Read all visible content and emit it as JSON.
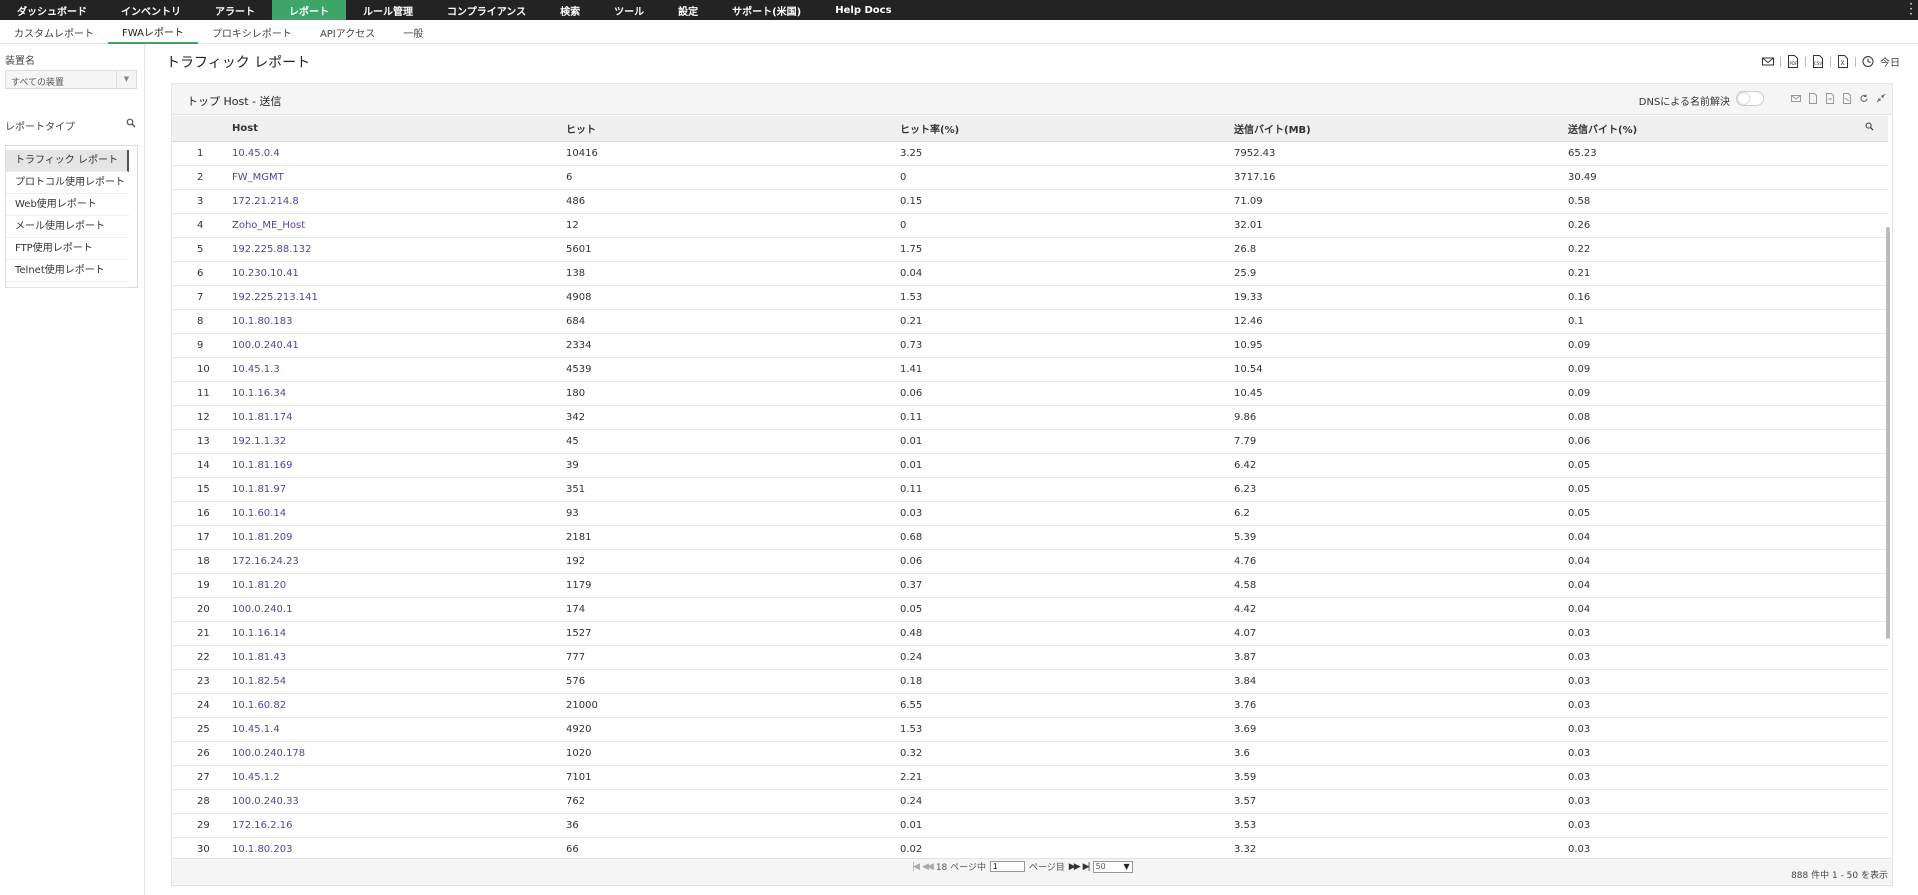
{
  "topnav": {
    "items": [
      "ダッシュボード",
      "インベントリ",
      "アラート",
      "レポート",
      "ルール管理",
      "コンプライアンス",
      "検索",
      "ツール",
      "設定",
      "サポート(米国)",
      "Help Docs"
    ]
  },
  "subnav": {
    "items": [
      "カスタムレポート",
      "FWAレポート",
      "プロキシレポート",
      "APIアクセス",
      "一般"
    ]
  },
  "sidebar": {
    "device_label": "装置名",
    "device_value": "すべての装置",
    "report_type_label": "レポートタイプ",
    "reports": [
      "トラフィック レポート",
      "プロトコル使用レポート",
      "Web使用レポート",
      "メール使用レポート",
      "FTP使用レポート",
      "Telnet使用レポート"
    ]
  },
  "header": {
    "title": "トラフィック レポート",
    "today": "今日"
  },
  "panel": {
    "title": "トップ Host - 送信",
    "dns_label": "DNSによる名前解決"
  },
  "table": {
    "columns": [
      "",
      "Host",
      "ヒット",
      "ヒット率(%)",
      "送信バイト(MB)",
      "送信バイト(%)"
    ],
    "rows": [
      [
        "1",
        "10.45.0.4",
        "10416",
        "3.25",
        "7952.43",
        "65.23"
      ],
      [
        "2",
        "FW_MGMT",
        "6",
        "0",
        "3717.16",
        "30.49"
      ],
      [
        "3",
        "172.21.214.8",
        "486",
        "0.15",
        "71.09",
        "0.58"
      ],
      [
        "4",
        "Zoho_ME_Host",
        "12",
        "0",
        "32.01",
        "0.26"
      ],
      [
        "5",
        "192.225.88.132",
        "5601",
        "1.75",
        "26.8",
        "0.22"
      ],
      [
        "6",
        "10.230.10.41",
        "138",
        "0.04",
        "25.9",
        "0.21"
      ],
      [
        "7",
        "192.225.213.141",
        "4908",
        "1.53",
        "19.33",
        "0.16"
      ],
      [
        "8",
        "10.1.80.183",
        "684",
        "0.21",
        "12.46",
        "0.1"
      ],
      [
        "9",
        "100.0.240.41",
        "2334",
        "0.73",
        "10.95",
        "0.09"
      ],
      [
        "10",
        "10.45.1.3",
        "4539",
        "1.41",
        "10.54",
        "0.09"
      ],
      [
        "11",
        "10.1.16.34",
        "180",
        "0.06",
        "10.45",
        "0.09"
      ],
      [
        "12",
        "10.1.81.174",
        "342",
        "0.11",
        "9.86",
        "0.08"
      ],
      [
        "13",
        "192.1.1.32",
        "45",
        "0.01",
        "7.79",
        "0.06"
      ],
      [
        "14",
        "10.1.81.169",
        "39",
        "0.01",
        "6.42",
        "0.05"
      ],
      [
        "15",
        "10.1.81.97",
        "351",
        "0.11",
        "6.23",
        "0.05"
      ],
      [
        "16",
        "10.1.60.14",
        "93",
        "0.03",
        "6.2",
        "0.05"
      ],
      [
        "17",
        "10.1.81.209",
        "2181",
        "0.68",
        "5.39",
        "0.04"
      ],
      [
        "18",
        "172.16.24.23",
        "192",
        "0.06",
        "4.76",
        "0.04"
      ],
      [
        "19",
        "10.1.81.20",
        "1179",
        "0.37",
        "4.58",
        "0.04"
      ],
      [
        "20",
        "100.0.240.1",
        "174",
        "0.05",
        "4.42",
        "0.04"
      ],
      [
        "21",
        "10.1.16.14",
        "1527",
        "0.48",
        "4.07",
        "0.03"
      ],
      [
        "22",
        "10.1.81.43",
        "777",
        "0.24",
        "3.87",
        "0.03"
      ],
      [
        "23",
        "10.1.82.54",
        "576",
        "0.18",
        "3.84",
        "0.03"
      ],
      [
        "24",
        "10.1.60.82",
        "21000",
        "6.55",
        "3.76",
        "0.03"
      ],
      [
        "25",
        "10.45.1.4",
        "4920",
        "1.53",
        "3.69",
        "0.03"
      ],
      [
        "26",
        "100.0.240.178",
        "1020",
        "0.32",
        "3.6",
        "0.03"
      ],
      [
        "27",
        "10.45.1.2",
        "7101",
        "2.21",
        "3.59",
        "0.03"
      ],
      [
        "28",
        "100.0.240.33",
        "762",
        "0.24",
        "3.57",
        "0.03"
      ],
      [
        "29",
        "172.16.2.16",
        "36",
        "0.01",
        "3.53",
        "0.03"
      ],
      [
        "30",
        "10.1.80.203",
        "66",
        "0.02",
        "3.32",
        "0.03"
      ]
    ]
  },
  "pager": {
    "total_pages_text": "18 ページ中",
    "current_page": "1",
    "page_suffix": "ページ目",
    "page_size": "50",
    "summary": "888 件中 1 - 50 を表示"
  },
  "colors": {
    "accent": "#3ca567",
    "link": "#5a3ea8",
    "topbar": "#232323"
  }
}
